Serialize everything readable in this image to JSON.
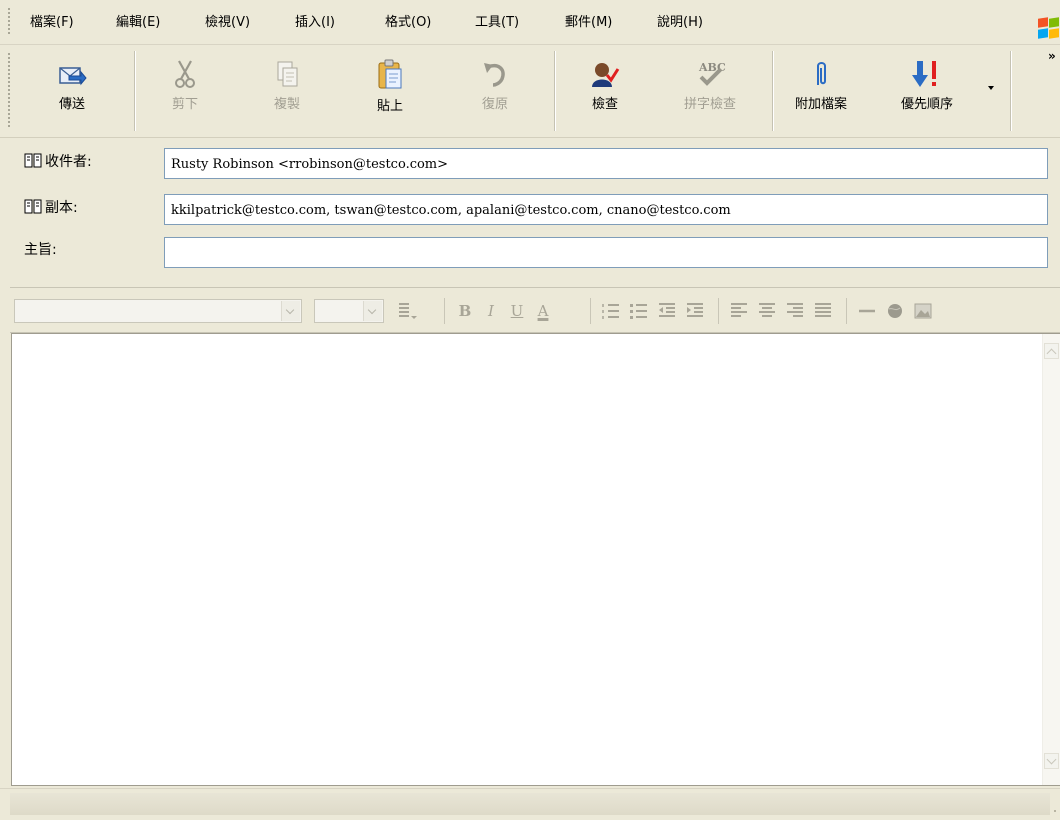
{
  "menu": {
    "items": [
      "檔案(F)",
      "編輯(E)",
      "檢視(V)",
      "插入(I)",
      "格式(O)",
      "工具(T)",
      "郵件(M)",
      "說明(H)"
    ]
  },
  "toolbar": {
    "send": "傳送",
    "cut": "剪下",
    "copy": "複製",
    "paste": "貼上",
    "undo": "復原",
    "check": "檢查",
    "spelling": "拼字檢查",
    "attach": "附加檔案",
    "priority": "優先順序",
    "more": "»",
    "spell_icon_text": "ABC"
  },
  "fields": {
    "to_label": "收件者:",
    "to_value": "Rusty Robinson <rrobinson@testco.com>",
    "cc_label": "副本:",
    "cc_value": "kkilpatrick@testco.com,  tswan@testco.com,  apalani@testco.com,  cnano@testco.com",
    "subject_label": "主旨:",
    "subject_value": ""
  },
  "format": {
    "bold": "B",
    "italic": "I",
    "underline": "U",
    "font_color": "A"
  },
  "body": {
    "text": ""
  },
  "colors": {
    "chrome": "#ece9d8",
    "field_border": "#7f9db9",
    "send_blue": "#2b6cc4",
    "priority_red": "#e02020",
    "disabled_gray": "#a19e92"
  }
}
